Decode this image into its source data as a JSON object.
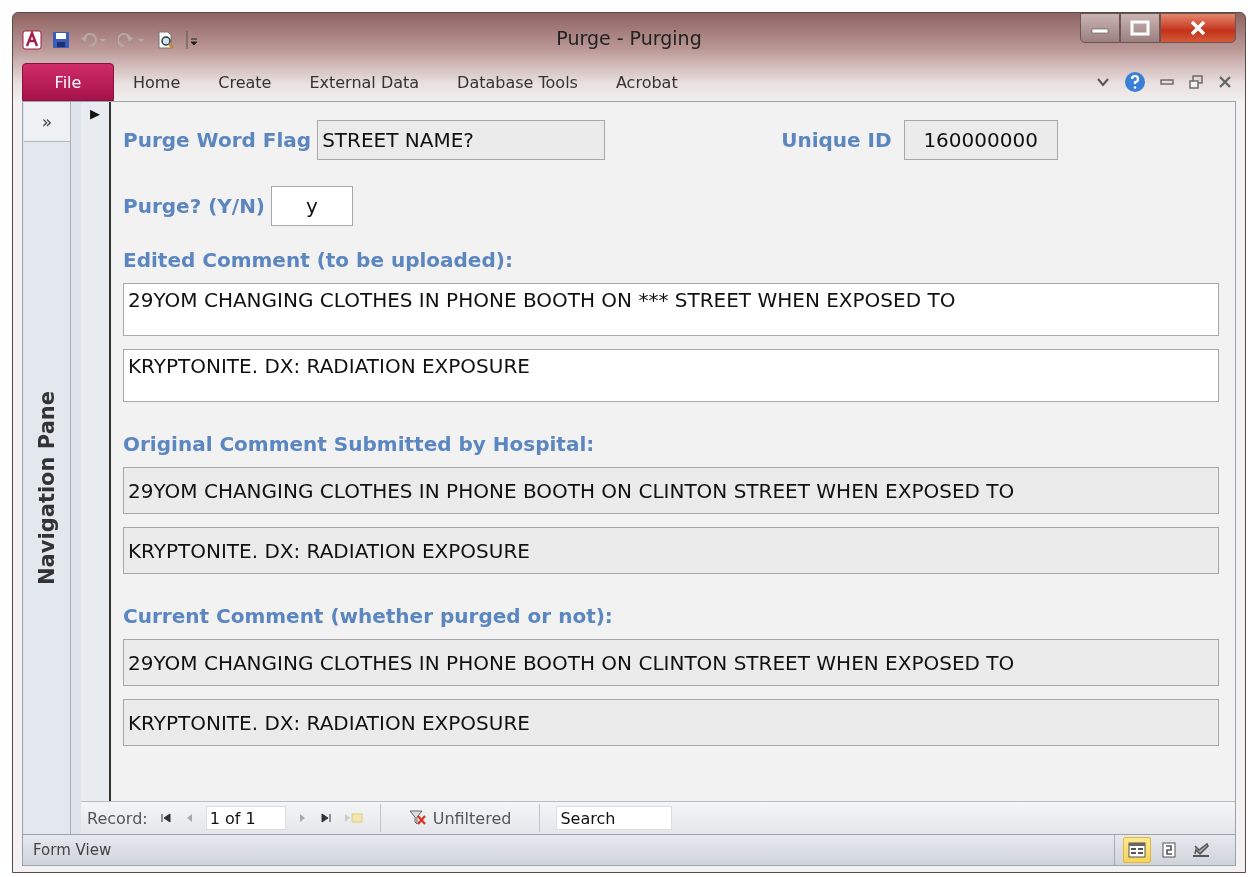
{
  "window": {
    "title": "Purge - Purging"
  },
  "ribbon": {
    "file_tab": "File",
    "tabs": [
      "Home",
      "Create",
      "External Data",
      "Database Tools",
      "Acrobat"
    ]
  },
  "nav_pane": {
    "toggle": "»",
    "label": "Navigation Pane"
  },
  "form": {
    "record_selector": "▶",
    "purge_word_flag": {
      "label": "Purge Word Flag",
      "value": "STREET NAME?"
    },
    "unique_id": {
      "label": "Unique ID",
      "value": "160000000"
    },
    "purge": {
      "label": "Purge? (Y/N)",
      "value": "y"
    },
    "sections": [
      {
        "label": "Edited Comment (to be uploaded):",
        "editable": true,
        "lines": [
          "29YOM CHANGING CLOTHES IN PHONE BOOTH ON *** STREET WHEN EXPOSED TO",
          "KRYPTONITE. DX: RADIATION EXPOSURE"
        ]
      },
      {
        "label": "Original Comment Submitted by Hospital:",
        "editable": false,
        "lines": [
          "29YOM CHANGING CLOTHES IN PHONE BOOTH ON CLINTON STREET WHEN EXPOSED TO",
          "KRYPTONITE. DX: RADIATION EXPOSURE"
        ]
      },
      {
        "label": "Current Comment (whether purged or not):",
        "editable": false,
        "lines": [
          "29YOM CHANGING CLOTHES IN PHONE BOOTH ON CLINTON STREET WHEN EXPOSED TO",
          "KRYPTONITE. DX: RADIATION EXPOSURE"
        ]
      }
    ]
  },
  "record_nav": {
    "label": "Record:",
    "position": "1 of 1",
    "filter": "Unfiltered",
    "search": {
      "placeholder": "Search"
    }
  },
  "status_bar": {
    "text": "Form View",
    "views": [
      {
        "kind": "form",
        "selected": true
      },
      {
        "kind": "layout",
        "selected": false
      },
      {
        "kind": "design",
        "selected": false
      }
    ]
  }
}
